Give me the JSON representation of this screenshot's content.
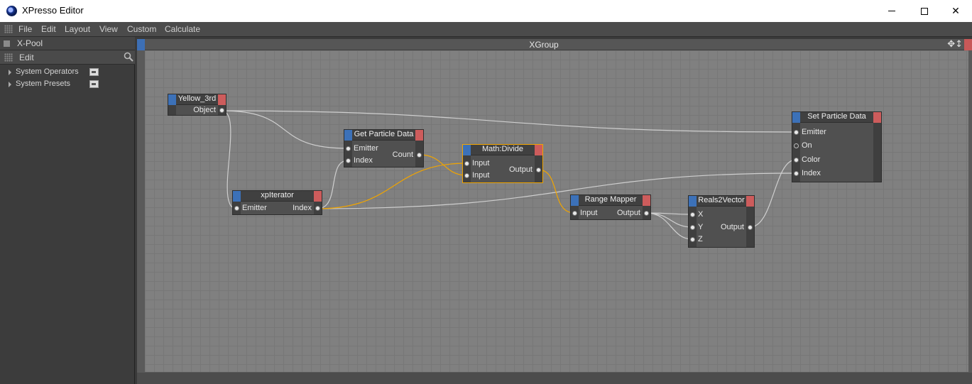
{
  "window": {
    "title": "XPresso Editor"
  },
  "menu": [
    "File",
    "Edit",
    "Layout",
    "View",
    "Custom",
    "Calculate"
  ],
  "pool": {
    "title": "X-Pool",
    "edit_label": "Edit",
    "items": [
      {
        "label": "System Operators"
      },
      {
        "label": "System Presets"
      }
    ]
  },
  "xgroup": {
    "title": "XGroup",
    "tools": "✥↕"
  },
  "nodes": {
    "yellow": {
      "title": "Yellow_3rd",
      "outputs": [
        "Object"
      ]
    },
    "iterator": {
      "title": "xpIterator",
      "inputs": [
        "Emitter"
      ],
      "outputs": [
        "Index"
      ]
    },
    "getparticle": {
      "title": "Get Particle Data",
      "inputs": [
        "Emitter",
        "Index"
      ],
      "outputs": [
        "Count"
      ]
    },
    "divide": {
      "title": "Math:Divide",
      "inputs": [
        "Input",
        "Input"
      ],
      "outputs": [
        "Output"
      ]
    },
    "rangemapper": {
      "title": "Range Mapper",
      "inputs": [
        "Input"
      ],
      "outputs": [
        "Output"
      ]
    },
    "reals2vector": {
      "title": "Reals2Vector",
      "inputs": [
        "X",
        "Y",
        "Z"
      ],
      "outputs": [
        "Output"
      ]
    },
    "setparticle": {
      "title": "Set Particle Data",
      "inputs": [
        "Emitter",
        "On",
        "Color",
        "Index"
      ]
    }
  },
  "colors": {
    "wire": "#cfcfcf",
    "wire_active": "#f0a400",
    "port_blue": "#3c71b8",
    "port_red": "#cd5c5c"
  }
}
